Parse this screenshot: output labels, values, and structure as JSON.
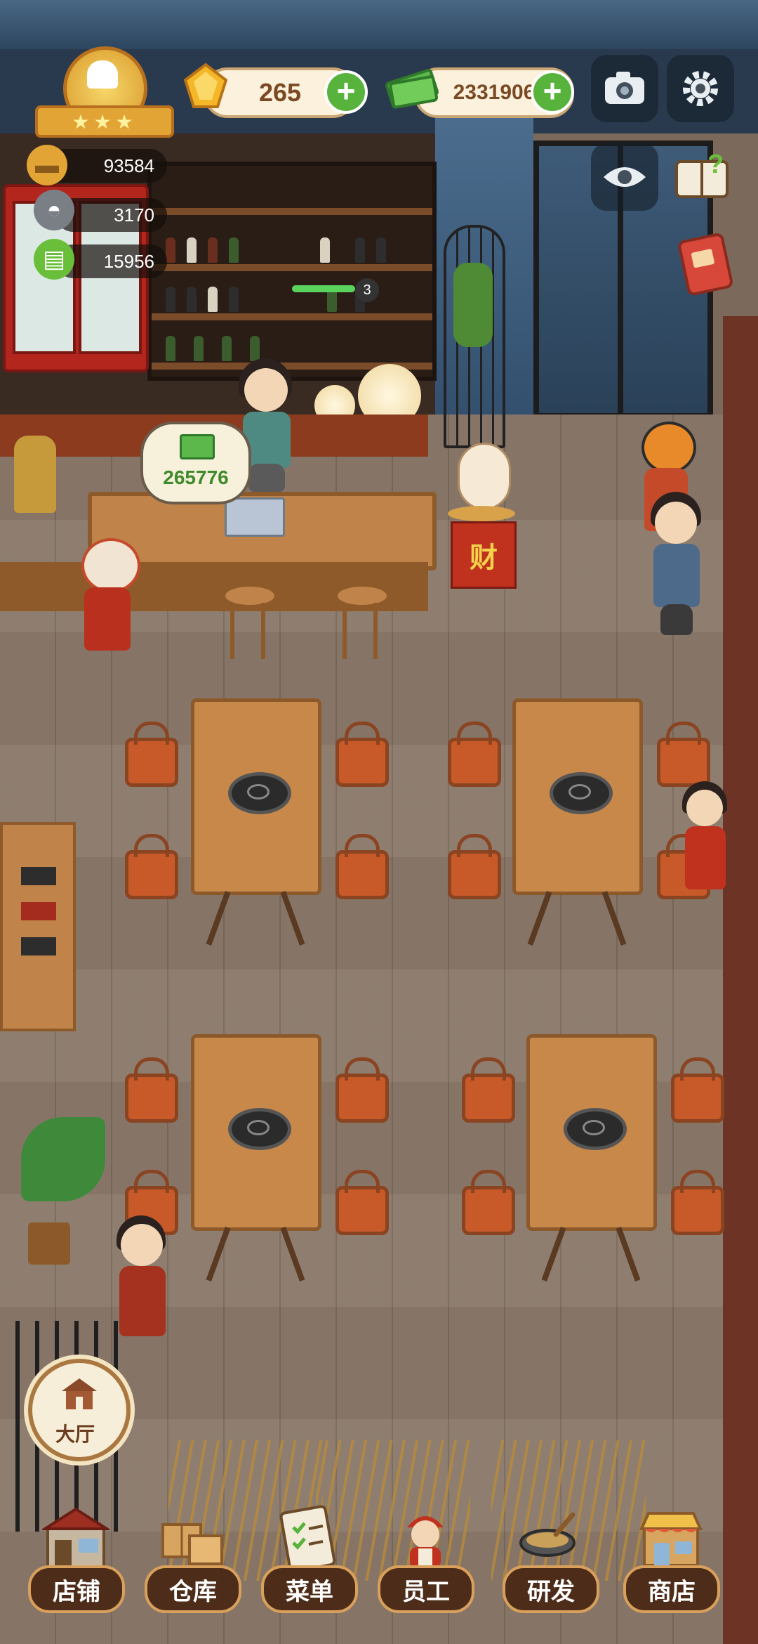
{
  "hud": {
    "gems": "265",
    "cash": "2331906",
    "stats": {
      "popularity": "93584",
      "dishes_served": "3170",
      "menu_points": "15956"
    },
    "shelf_stock_badge": "3"
  },
  "scene": {
    "cashier_bubble_amount": "265776",
    "fortune_box_char": "财"
  },
  "hall_button": {
    "label": "大厅"
  },
  "bottom_nav": {
    "items": [
      {
        "label": "店铺",
        "icon": "storefront-icon"
      },
      {
        "label": "仓库",
        "icon": "warehouse-boxes-icon"
      },
      {
        "label": "菜单",
        "icon": "menu-clipboard-icon"
      },
      {
        "label": "员工",
        "icon": "staff-chef-icon"
      },
      {
        "label": "研发",
        "icon": "research-wok-icon"
      },
      {
        "label": "商店",
        "icon": "shop-icon"
      }
    ]
  },
  "colors": {
    "accent_green": "#58b33c",
    "hud_text": "#7a4a24",
    "nav_label_bg": "#4d2d1a"
  }
}
